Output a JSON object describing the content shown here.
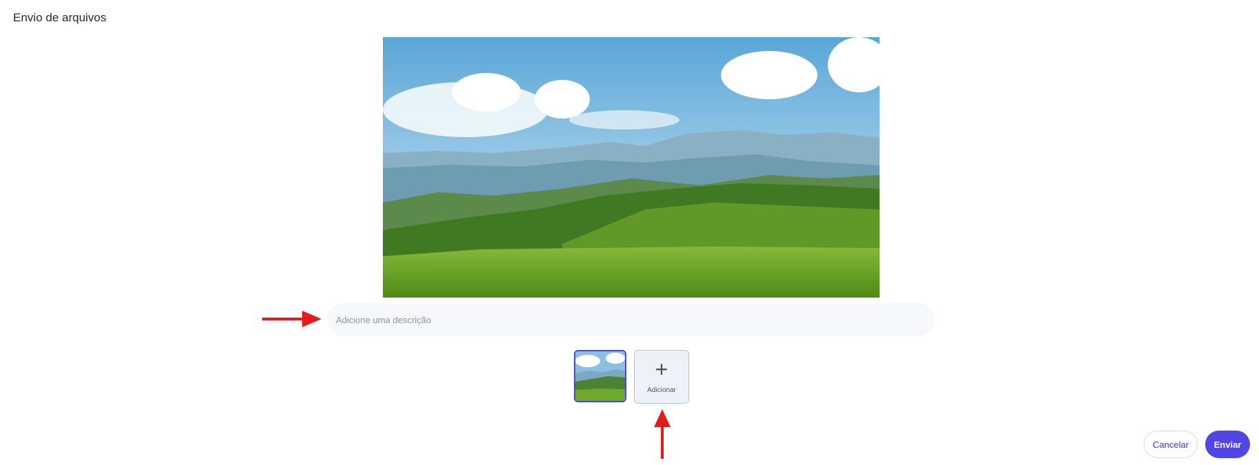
{
  "header": {
    "title": "Envio de arquivos"
  },
  "description": {
    "placeholder": "Adicione uma descrição",
    "value": ""
  },
  "attachments": {
    "add_label": "Adicionar",
    "selected_index": 0
  },
  "footer": {
    "cancel_label": "Cancelar",
    "send_label": "Enviar"
  },
  "colors": {
    "accent": "#4f46e5",
    "annotation_arrow": "#e31b1b"
  }
}
